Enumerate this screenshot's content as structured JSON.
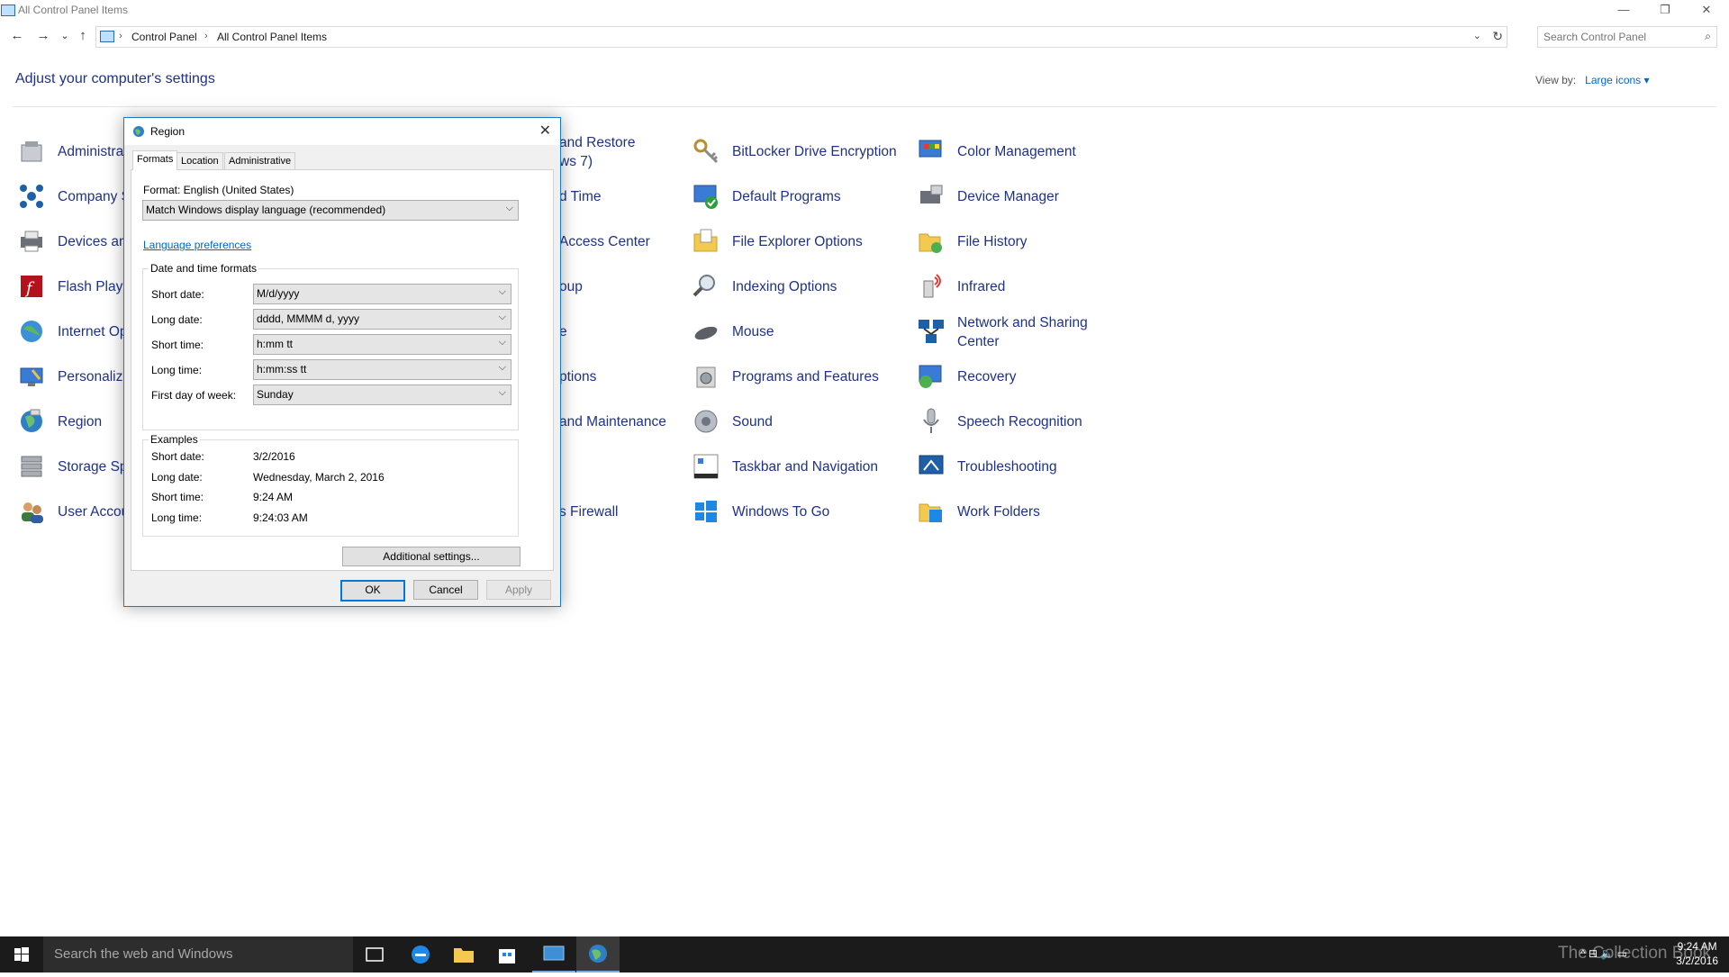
{
  "window": {
    "title": "All Control Panel Items",
    "minimize": "—",
    "restore": "❐",
    "close": "✕"
  },
  "nav": {
    "back": "←",
    "forward": "→",
    "recent": "⌄",
    "up": "↑"
  },
  "address": {
    "crumbs": [
      "Control Panel",
      "All Control Panel Items"
    ],
    "sep": "›",
    "dropdown": "⌄",
    "refresh": "↻"
  },
  "search": {
    "placeholder": "Search Control Panel",
    "icon": "⌕"
  },
  "heading": "Adjust your computer's settings",
  "view_by": {
    "label": "View by:",
    "value": "Large icons ▾"
  },
  "items": {
    "col1": [
      "Administra",
      "Company S",
      "Devices an",
      "Flash Playe",
      "Internet Op",
      "Personaliza",
      "Region",
      "Storage Sp",
      "User Accou"
    ],
    "col2": [
      "and Restore\nws 7)",
      "d Time",
      "Access Center",
      "oup",
      "e",
      "ptions",
      "and Maintenance",
      "",
      "s Firewall"
    ],
    "col3": [
      "BitLocker Drive Encryption",
      "Default Programs",
      "File Explorer Options",
      "Indexing Options",
      "Mouse",
      "Programs and Features",
      "Sound",
      "Taskbar and Navigation",
      "Windows To Go"
    ],
    "col4": [
      "Color Management",
      "Device Manager",
      "File History",
      "Infrared",
      "Network and Sharing\nCenter",
      "Recovery",
      "Speech Recognition",
      "Troubleshooting",
      "Work Folders"
    ]
  },
  "dialog": {
    "title": "Region",
    "close": "✕",
    "tabs": [
      "Formats",
      "Location",
      "Administrative"
    ],
    "format_label": "Format: English (United States)",
    "format_value": "Match Windows display language (recommended)",
    "language_link": "Language preferences",
    "dt_group": "Date and time formats",
    "fields": [
      {
        "label": "Short date:",
        "value": "M/d/yyyy"
      },
      {
        "label": "Long date:",
        "value": "dddd, MMMM d, yyyy"
      },
      {
        "label": "Short time:",
        "value": "h:mm tt"
      },
      {
        "label": "Long time:",
        "value": "h:mm:ss tt"
      },
      {
        "label": "First day of week:",
        "value": "Sunday"
      }
    ],
    "examples_group": "Examples",
    "examples": [
      {
        "label": "Short date:",
        "value": "3/2/2016"
      },
      {
        "label": "Long date:",
        "value": "Wednesday, March 2, 2016"
      },
      {
        "label": "Short time:",
        "value": "9:24 AM"
      },
      {
        "label": "Long time:",
        "value": "9:24:03 AM"
      }
    ],
    "additional": "Additional settings...",
    "ok": "OK",
    "cancel": "Cancel",
    "apply": "Apply",
    "arrow": "⌵"
  },
  "taskbar": {
    "search": "Search the web and Windows",
    "tray": "^  ⊟  🔈  ▭",
    "time": "9:24 AM",
    "date": "3/2/2016",
    "watermark": "The Collection Book"
  }
}
